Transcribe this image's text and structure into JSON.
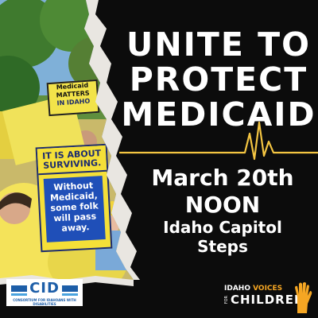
{
  "poster": {
    "headline_lines": [
      "UNITE TO",
      "PROTECT",
      "MEDICAID"
    ],
    "event": {
      "date": "March 20th",
      "time": "NOON",
      "place_line1": "Idaho Capitol",
      "place_line2": "Steps"
    }
  },
  "signs": {
    "medicaid_matters": {
      "line1": "Medicaid",
      "line2": "MATTERS",
      "line3": "IN IDAHO"
    },
    "surviving": {
      "header_line1": "IT IS ABOUT",
      "header_line2": "SURVIVING.",
      "body_line1": "Without",
      "body_line2": "Medicaid,",
      "body_line3": "some folk",
      "body_line4": "will pass",
      "body_line5": "away."
    }
  },
  "logos": {
    "cid": {
      "name": "CID",
      "subtitle": "CONSORTIUM FOR IDAHOANS WITH DISABILITIES"
    },
    "ivc": {
      "line1_a": "IDAHO",
      "line1_b": "VOICES",
      "for": "FOR",
      "line2": "CHILDREN"
    }
  },
  "colors": {
    "background": "#0c0c0c",
    "text": "#ffffff",
    "heartbeat": "#f4c542",
    "sign_yellow": "#f4df38",
    "sign_blue": "#1f4fb8",
    "cid_blue": "#1d5ea8",
    "ivc_orange": "#f5a623"
  },
  "icons": [
    "heartbeat-line-icon",
    "raised-hand-icon"
  ]
}
